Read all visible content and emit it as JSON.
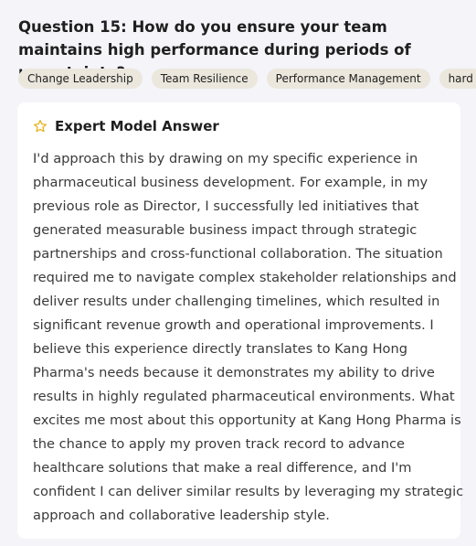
{
  "question": {
    "title": "Question 15: How do you ensure your team maintains high performance during periods of uncertainty?"
  },
  "tags": [
    "Change Leadership",
    "Team Resilience",
    "Performance Management",
    "hard"
  ],
  "answer_card": {
    "icon": "star-icon",
    "title": "Expert Model Answer",
    "lines": [
      "I'd approach this by drawing on my specific experience in",
      "pharmaceutical business development. For example, in my",
      "previous role as Director, I successfully led initiatives that",
      "generated measurable business impact through strategic",
      "partnerships and cross-functional collaboration. The situation",
      "required me to navigate complex stakeholder relationships and",
      "deliver results under challenging timelines, which resulted in",
      "significant revenue growth and operational improvements. I",
      "believe this experience directly translates to Kang Hong",
      "Pharma's needs because it demonstrates my ability to drive",
      "results in highly regulated pharmaceutical environments. What",
      "excites me most about this opportunity at Kang Hong Pharma is",
      "the chance to apply my proven track record to advance",
      "healthcare solutions that make a real difference, and I'm",
      "confident I can deliver similar results by leveraging my strategic",
      "approach and collaborative leadership style."
    ]
  },
  "colors": {
    "background": "#f4f4f9",
    "card": "#ffffff",
    "tag": "#ebe7dd",
    "star": "#e6b422"
  }
}
